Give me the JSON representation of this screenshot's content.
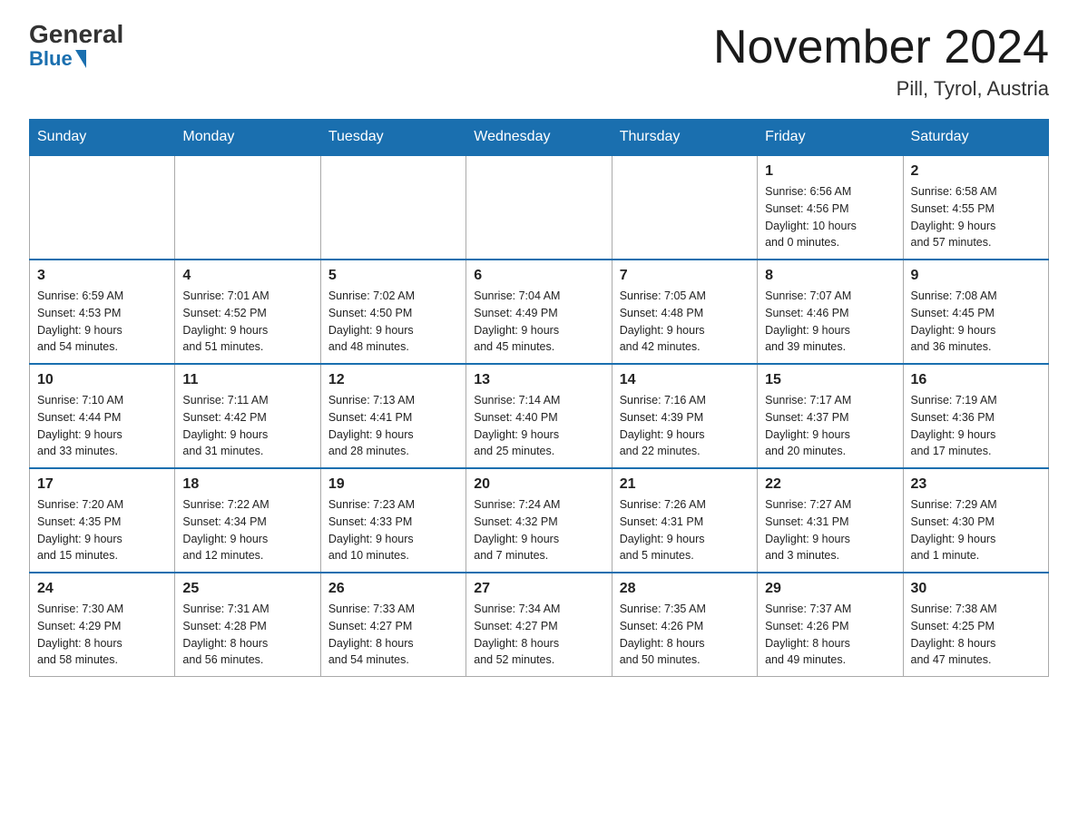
{
  "header": {
    "logo_general": "General",
    "logo_blue": "Blue",
    "title": "November 2024",
    "subtitle": "Pill, Tyrol, Austria"
  },
  "weekdays": [
    "Sunday",
    "Monday",
    "Tuesday",
    "Wednesday",
    "Thursday",
    "Friday",
    "Saturday"
  ],
  "weeks": [
    [
      {
        "day": "",
        "info": ""
      },
      {
        "day": "",
        "info": ""
      },
      {
        "day": "",
        "info": ""
      },
      {
        "day": "",
        "info": ""
      },
      {
        "day": "",
        "info": ""
      },
      {
        "day": "1",
        "info": "Sunrise: 6:56 AM\nSunset: 4:56 PM\nDaylight: 10 hours\nand 0 minutes."
      },
      {
        "day": "2",
        "info": "Sunrise: 6:58 AM\nSunset: 4:55 PM\nDaylight: 9 hours\nand 57 minutes."
      }
    ],
    [
      {
        "day": "3",
        "info": "Sunrise: 6:59 AM\nSunset: 4:53 PM\nDaylight: 9 hours\nand 54 minutes."
      },
      {
        "day": "4",
        "info": "Sunrise: 7:01 AM\nSunset: 4:52 PM\nDaylight: 9 hours\nand 51 minutes."
      },
      {
        "day": "5",
        "info": "Sunrise: 7:02 AM\nSunset: 4:50 PM\nDaylight: 9 hours\nand 48 minutes."
      },
      {
        "day": "6",
        "info": "Sunrise: 7:04 AM\nSunset: 4:49 PM\nDaylight: 9 hours\nand 45 minutes."
      },
      {
        "day": "7",
        "info": "Sunrise: 7:05 AM\nSunset: 4:48 PM\nDaylight: 9 hours\nand 42 minutes."
      },
      {
        "day": "8",
        "info": "Sunrise: 7:07 AM\nSunset: 4:46 PM\nDaylight: 9 hours\nand 39 minutes."
      },
      {
        "day": "9",
        "info": "Sunrise: 7:08 AM\nSunset: 4:45 PM\nDaylight: 9 hours\nand 36 minutes."
      }
    ],
    [
      {
        "day": "10",
        "info": "Sunrise: 7:10 AM\nSunset: 4:44 PM\nDaylight: 9 hours\nand 33 minutes."
      },
      {
        "day": "11",
        "info": "Sunrise: 7:11 AM\nSunset: 4:42 PM\nDaylight: 9 hours\nand 31 minutes."
      },
      {
        "day": "12",
        "info": "Sunrise: 7:13 AM\nSunset: 4:41 PM\nDaylight: 9 hours\nand 28 minutes."
      },
      {
        "day": "13",
        "info": "Sunrise: 7:14 AM\nSunset: 4:40 PM\nDaylight: 9 hours\nand 25 minutes."
      },
      {
        "day": "14",
        "info": "Sunrise: 7:16 AM\nSunset: 4:39 PM\nDaylight: 9 hours\nand 22 minutes."
      },
      {
        "day": "15",
        "info": "Sunrise: 7:17 AM\nSunset: 4:37 PM\nDaylight: 9 hours\nand 20 minutes."
      },
      {
        "day": "16",
        "info": "Sunrise: 7:19 AM\nSunset: 4:36 PM\nDaylight: 9 hours\nand 17 minutes."
      }
    ],
    [
      {
        "day": "17",
        "info": "Sunrise: 7:20 AM\nSunset: 4:35 PM\nDaylight: 9 hours\nand 15 minutes."
      },
      {
        "day": "18",
        "info": "Sunrise: 7:22 AM\nSunset: 4:34 PM\nDaylight: 9 hours\nand 12 minutes."
      },
      {
        "day": "19",
        "info": "Sunrise: 7:23 AM\nSunset: 4:33 PM\nDaylight: 9 hours\nand 10 minutes."
      },
      {
        "day": "20",
        "info": "Sunrise: 7:24 AM\nSunset: 4:32 PM\nDaylight: 9 hours\nand 7 minutes."
      },
      {
        "day": "21",
        "info": "Sunrise: 7:26 AM\nSunset: 4:31 PM\nDaylight: 9 hours\nand 5 minutes."
      },
      {
        "day": "22",
        "info": "Sunrise: 7:27 AM\nSunset: 4:31 PM\nDaylight: 9 hours\nand 3 minutes."
      },
      {
        "day": "23",
        "info": "Sunrise: 7:29 AM\nSunset: 4:30 PM\nDaylight: 9 hours\nand 1 minute."
      }
    ],
    [
      {
        "day": "24",
        "info": "Sunrise: 7:30 AM\nSunset: 4:29 PM\nDaylight: 8 hours\nand 58 minutes."
      },
      {
        "day": "25",
        "info": "Sunrise: 7:31 AM\nSunset: 4:28 PM\nDaylight: 8 hours\nand 56 minutes."
      },
      {
        "day": "26",
        "info": "Sunrise: 7:33 AM\nSunset: 4:27 PM\nDaylight: 8 hours\nand 54 minutes."
      },
      {
        "day": "27",
        "info": "Sunrise: 7:34 AM\nSunset: 4:27 PM\nDaylight: 8 hours\nand 52 minutes."
      },
      {
        "day": "28",
        "info": "Sunrise: 7:35 AM\nSunset: 4:26 PM\nDaylight: 8 hours\nand 50 minutes."
      },
      {
        "day": "29",
        "info": "Sunrise: 7:37 AM\nSunset: 4:26 PM\nDaylight: 8 hours\nand 49 minutes."
      },
      {
        "day": "30",
        "info": "Sunrise: 7:38 AM\nSunset: 4:25 PM\nDaylight: 8 hours\nand 47 minutes."
      }
    ]
  ]
}
